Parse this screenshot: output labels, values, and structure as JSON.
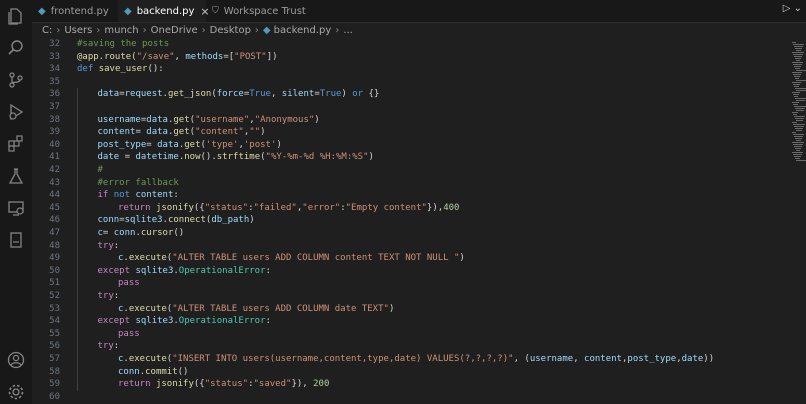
{
  "tabs": [
    {
      "label": "frontend.py",
      "active": false
    },
    {
      "label": "backend.py",
      "active": true
    },
    {
      "label": "Workspace Trust",
      "active": false
    }
  ],
  "breadcrumb": [
    "C:",
    "Users",
    "munch",
    "OneDrive",
    "Desktop",
    "backend.py",
    "..."
  ],
  "icons": {
    "activity": [
      "explorer-icon",
      "search-icon",
      "source-control-icon",
      "run-debug-icon",
      "extensions-icon",
      "testing-icon",
      "remote-explorer-icon",
      "notebook-icon"
    ],
    "bottom": [
      "account-icon",
      "settings-gear-icon"
    ]
  },
  "colors": {
    "keyword": "#569cd6",
    "control": "#c586c0",
    "string": "#ce9178",
    "comment": "#6a9955",
    "function": "#dcdcaa",
    "variable": "#9cdcfe",
    "class": "#4ec9b0",
    "number": "#b5cea8"
  },
  "code_lines": [
    {
      "n": "32",
      "indent": 0,
      "tokens": [
        [
          "cmt",
          "#saving the posts"
        ]
      ]
    },
    {
      "n": "33",
      "indent": 0,
      "tokens": [
        [
          "dec",
          "@app.route("
        ],
        [
          "str",
          "\"/save\""
        ],
        [
          "plain",
          ", "
        ],
        [
          "var",
          "methods"
        ],
        [
          "op",
          "=["
        ],
        [
          "str",
          "\"POST\""
        ],
        [
          "plain",
          "])"
        ]
      ]
    },
    {
      "n": "34",
      "indent": 0,
      "tokens": [
        [
          "kw",
          "def "
        ],
        [
          "fn",
          "save_user"
        ],
        [
          "plain",
          "():"
        ]
      ]
    },
    {
      "n": "35",
      "indent": 0,
      "tokens": []
    },
    {
      "n": "36",
      "indent": 1,
      "tokens": [
        [
          "var",
          "data"
        ],
        [
          "op",
          "="
        ],
        [
          "var",
          "request"
        ],
        [
          "plain",
          "."
        ],
        [
          "fn",
          "get_json"
        ],
        [
          "plain",
          "("
        ],
        [
          "var",
          "force"
        ],
        [
          "op",
          "="
        ],
        [
          "kw",
          "True"
        ],
        [
          "plain",
          ", "
        ],
        [
          "var",
          "silent"
        ],
        [
          "op",
          "="
        ],
        [
          "kw",
          "True"
        ],
        [
          "plain",
          ") "
        ],
        [
          "kw",
          "or"
        ],
        [
          "plain",
          " {}"
        ]
      ]
    },
    {
      "n": "37",
      "indent": 0,
      "tokens": []
    },
    {
      "n": "38",
      "indent": 1,
      "tokens": [
        [
          "var",
          "username"
        ],
        [
          "op",
          "="
        ],
        [
          "var",
          "data"
        ],
        [
          "plain",
          "."
        ],
        [
          "fn",
          "get"
        ],
        [
          "plain",
          "("
        ],
        [
          "str",
          "\"username\""
        ],
        [
          "plain",
          ","
        ],
        [
          "str",
          "\"Anonymous\""
        ],
        [
          "plain",
          ")"
        ]
      ]
    },
    {
      "n": "39",
      "indent": 1,
      "tokens": [
        [
          "var",
          "content"
        ],
        [
          "op",
          "= "
        ],
        [
          "var",
          "data"
        ],
        [
          "plain",
          "."
        ],
        [
          "fn",
          "get"
        ],
        [
          "plain",
          "("
        ],
        [
          "str",
          "\"content\""
        ],
        [
          "plain",
          ","
        ],
        [
          "str",
          "\"\""
        ],
        [
          "plain",
          ")"
        ]
      ]
    },
    {
      "n": "40",
      "indent": 1,
      "tokens": [
        [
          "var",
          "post_type"
        ],
        [
          "op",
          "= "
        ],
        [
          "var",
          "data"
        ],
        [
          "plain",
          "."
        ],
        [
          "fn",
          "get"
        ],
        [
          "plain",
          "("
        ],
        [
          "str",
          "'type'"
        ],
        [
          "plain",
          ","
        ],
        [
          "str",
          "'post'"
        ],
        [
          "plain",
          ")"
        ]
      ]
    },
    {
      "n": "41",
      "indent": 1,
      "tokens": [
        [
          "var",
          "date"
        ],
        [
          "op",
          " = "
        ],
        [
          "var",
          "datetime"
        ],
        [
          "plain",
          "."
        ],
        [
          "fn",
          "now"
        ],
        [
          "plain",
          "()."
        ],
        [
          "fn",
          "strftime"
        ],
        [
          "plain",
          "("
        ],
        [
          "str",
          "\"%Y-%m-%d %H:%M:%S\""
        ],
        [
          "plain",
          ")"
        ]
      ]
    },
    {
      "n": "42",
      "indent": 1,
      "tokens": [
        [
          "cmt",
          "#"
        ]
      ]
    },
    {
      "n": "43",
      "indent": 1,
      "tokens": [
        [
          "cmt",
          "#error fallback"
        ]
      ]
    },
    {
      "n": "44",
      "indent": 1,
      "tokens": [
        [
          "ctl",
          "if "
        ],
        [
          "kw",
          "not "
        ],
        [
          "var",
          "content"
        ],
        [
          "plain",
          ":"
        ]
      ]
    },
    {
      "n": "45",
      "indent": 2,
      "tokens": [
        [
          "ctl",
          "return "
        ],
        [
          "fn",
          "jsonify"
        ],
        [
          "plain",
          "({"
        ],
        [
          "str",
          "\"status\""
        ],
        [
          "plain",
          ":"
        ],
        [
          "str",
          "\"failed\""
        ],
        [
          "plain",
          ","
        ],
        [
          "str",
          "\"error\""
        ],
        [
          "plain",
          ":"
        ],
        [
          "str",
          "\"Empty content\""
        ],
        [
          "plain",
          "}),"
        ],
        [
          "num",
          "400"
        ]
      ]
    },
    {
      "n": "46",
      "indent": 1,
      "tokens": [
        [
          "var",
          "conn"
        ],
        [
          "op",
          "="
        ],
        [
          "var",
          "sqlite3"
        ],
        [
          "plain",
          "."
        ],
        [
          "fn",
          "connect"
        ],
        [
          "plain",
          "("
        ],
        [
          "var",
          "db_path"
        ],
        [
          "plain",
          ")"
        ]
      ]
    },
    {
      "n": "47",
      "indent": 1,
      "tokens": [
        [
          "var",
          "c"
        ],
        [
          "op",
          "= "
        ],
        [
          "var",
          "conn"
        ],
        [
          "plain",
          "."
        ],
        [
          "fn",
          "cursor"
        ],
        [
          "plain",
          "()"
        ]
      ]
    },
    {
      "n": "48",
      "indent": 1,
      "tokens": [
        [
          "ctl",
          "try"
        ],
        [
          "plain",
          ":"
        ]
      ]
    },
    {
      "n": "49",
      "indent": 2,
      "tokens": [
        [
          "var",
          "c"
        ],
        [
          "plain",
          "."
        ],
        [
          "fn",
          "execute"
        ],
        [
          "plain",
          "("
        ],
        [
          "str",
          "\"ALTER TABLE users ADD COLUMN content TEXT NOT NULL \""
        ],
        [
          "plain",
          ")"
        ]
      ]
    },
    {
      "n": "50",
      "indent": 1,
      "tokens": [
        [
          "ctl",
          "except "
        ],
        [
          "var",
          "sqlite3"
        ],
        [
          "plain",
          "."
        ],
        [
          "cls",
          "OperationalError"
        ],
        [
          "plain",
          ":"
        ]
      ]
    },
    {
      "n": "51",
      "indent": 2,
      "tokens": [
        [
          "ctl",
          "pass"
        ]
      ]
    },
    {
      "n": "52",
      "indent": 1,
      "tokens": [
        [
          "ctl",
          "try"
        ],
        [
          "plain",
          ":"
        ]
      ]
    },
    {
      "n": "53",
      "indent": 2,
      "tokens": [
        [
          "var",
          "c"
        ],
        [
          "plain",
          "."
        ],
        [
          "fn",
          "execute"
        ],
        [
          "plain",
          "("
        ],
        [
          "str",
          "\"ALTER TABLE users ADD COLUMN date TEXT\""
        ],
        [
          "plain",
          ")"
        ]
      ]
    },
    {
      "n": "54",
      "indent": 1,
      "tokens": [
        [
          "ctl",
          "except "
        ],
        [
          "var",
          "sqlite3"
        ],
        [
          "plain",
          "."
        ],
        [
          "cls",
          "OperationalError"
        ],
        [
          "plain",
          ":"
        ]
      ]
    },
    {
      "n": "55",
      "indent": 2,
      "tokens": [
        [
          "ctl",
          "pass"
        ]
      ]
    },
    {
      "n": "56",
      "indent": 1,
      "tokens": [
        [
          "ctl",
          "try"
        ],
        [
          "plain",
          ":"
        ]
      ]
    },
    {
      "n": "57",
      "indent": 2,
      "tokens": [
        [
          "var",
          "c"
        ],
        [
          "plain",
          "."
        ],
        [
          "fn",
          "execute"
        ],
        [
          "plain",
          "("
        ],
        [
          "str",
          "\"INSERT INTO users(username,content,type,date) VALUES(?,?,?,?)\""
        ],
        [
          "plain",
          ", ("
        ],
        [
          "var",
          "username"
        ],
        [
          "plain",
          ", "
        ],
        [
          "var",
          "content"
        ],
        [
          "plain",
          ","
        ],
        [
          "var",
          "post_type"
        ],
        [
          "plain",
          ","
        ],
        [
          "var",
          "date"
        ],
        [
          "plain",
          "))"
        ]
      ]
    },
    {
      "n": "58",
      "indent": 2,
      "tokens": [
        [
          "var",
          "conn"
        ],
        [
          "plain",
          "."
        ],
        [
          "fn",
          "commit"
        ],
        [
          "plain",
          "()"
        ]
      ]
    },
    {
      "n": "59",
      "indent": 2,
      "tokens": [
        [
          "ctl",
          "return "
        ],
        [
          "fn",
          "jsonify"
        ],
        [
          "plain",
          "({"
        ],
        [
          "str",
          "\"status\""
        ],
        [
          "plain",
          ":"
        ],
        [
          "str",
          "\"saved\""
        ],
        [
          "plain",
          "}), "
        ],
        [
          "num",
          "200"
        ]
      ]
    },
    {
      "n": "60",
      "indent": 0,
      "tokens": []
    }
  ]
}
